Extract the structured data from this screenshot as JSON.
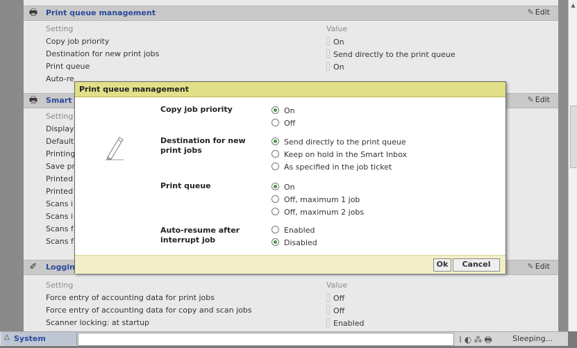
{
  "sections": {
    "print_queue": {
      "title": "Print queue management",
      "edit": "Edit",
      "header": {
        "setting": "Setting",
        "value": "Value"
      },
      "rows": [
        {
          "setting": "Copy job priority",
          "value": "On"
        },
        {
          "setting": "Destination for new print jobs",
          "value": "Send directly to the print queue"
        },
        {
          "setting": "Print queue",
          "value": "On"
        },
        {
          "setting": "Auto-re",
          "value": ""
        }
      ]
    },
    "smart": {
      "title": "Smart",
      "edit": "Edit",
      "header": {
        "setting": "Setting"
      },
      "rows": [
        "Display",
        "Default",
        "Printing",
        "Save pr",
        "Printed",
        "Printed",
        "Scans i",
        "Scans i",
        "Scans f",
        "Scans f"
      ]
    },
    "logging": {
      "title": "Loggin",
      "edit": "Edit",
      "header": {
        "setting": "Setting",
        "value": "Value"
      },
      "rows": [
        {
          "setting": "Force entry of accounting data for print jobs",
          "value": "Off"
        },
        {
          "setting": "Force entry of accounting data for copy and scan jobs",
          "value": "Off"
        },
        {
          "setting": "Scanner locking: at startup",
          "value": "Enabled"
        }
      ]
    }
  },
  "dialog": {
    "title": "Print queue management",
    "groups": [
      {
        "label": "Copy job priority",
        "options": [
          {
            "text": "On",
            "selected": true
          },
          {
            "text": "Off",
            "selected": false
          }
        ]
      },
      {
        "label": "Destination for new print jobs",
        "options": [
          {
            "text": "Send directly to the print queue",
            "selected": true
          },
          {
            "text": "Keep on hold in the Smart Inbox",
            "selected": false
          },
          {
            "text": "As specified in the job ticket",
            "selected": false
          }
        ]
      },
      {
        "label": "Print queue",
        "options": [
          {
            "text": "On",
            "selected": true
          },
          {
            "text": "Off, maximum 1 job",
            "selected": false
          },
          {
            "text": "Off, maximum 2 jobs",
            "selected": false
          }
        ]
      },
      {
        "label": "Auto-resume after interrupt job",
        "options": [
          {
            "text": "Enabled",
            "selected": false
          },
          {
            "text": "Disabled",
            "selected": true
          }
        ]
      }
    ],
    "ok": "Ok",
    "cancel": "Cancel"
  },
  "taskbar": {
    "tab_label": "System",
    "status": "Sleeping..."
  },
  "colors": {
    "accent_title": "#2a4a9a",
    "dialog_title_bg": "#e2df89",
    "radio_selected": "#3c9c35"
  },
  "icons": {
    "section_print": "printer-icon",
    "section_logging": "pen-icon",
    "edit": "pencil-icon"
  }
}
